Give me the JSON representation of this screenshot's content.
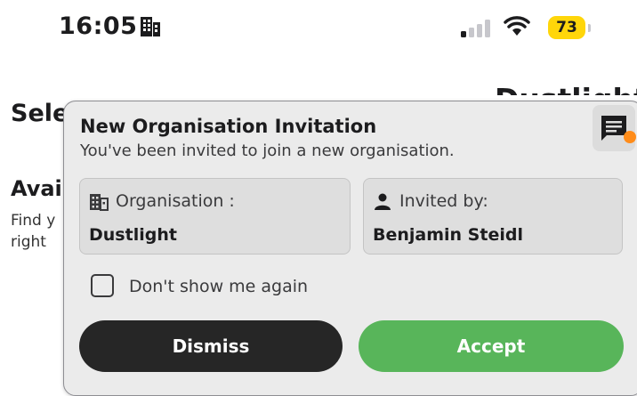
{
  "status_bar": {
    "time": "16:05",
    "battery": "73",
    "icons": [
      "building-icon",
      "signal-icon",
      "wifi-icon"
    ]
  },
  "background": {
    "left_title": "Sele",
    "right_title": "Dustlight",
    "section_title": "Avai",
    "section_desc": "Find y right"
  },
  "modal": {
    "title": "New Organisation Invitation",
    "subtitle": "You've been invited to join a new organisation.",
    "organisation_label": "Organisation :",
    "organisation_value": "Dustlight",
    "invited_by_label": "Invited by:",
    "invited_by_value": "Benjamin Steidl",
    "checkbox_label": "Don't show me again",
    "checkbox_checked": false,
    "dismiss_label": "Dismiss",
    "accept_label": "Accept"
  },
  "colors": {
    "accept": "#58b55a",
    "dismiss": "#262626",
    "battery": "#ffd60a",
    "notification_dot": "#ff8c1a"
  }
}
